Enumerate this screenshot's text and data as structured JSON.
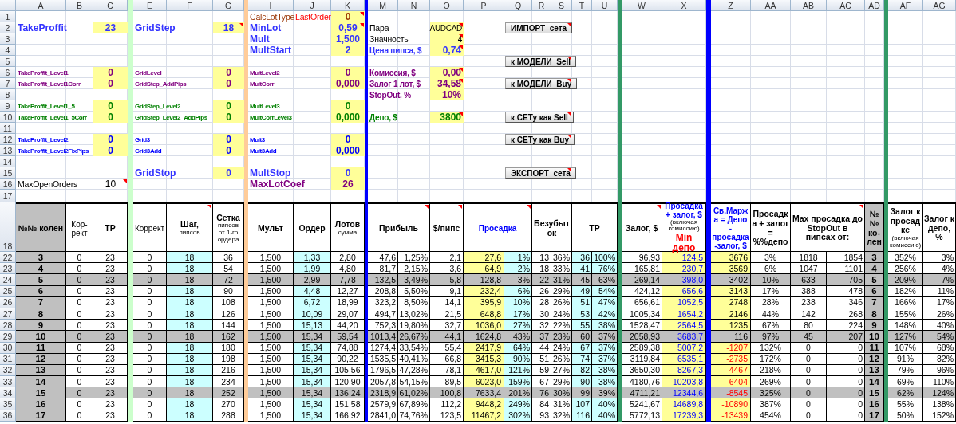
{
  "columns": [
    {
      "label": "A"
    },
    {
      "label": "B"
    },
    {
      "label": "C"
    },
    {
      "kind": "separator",
      "color": "#ccffcc"
    },
    {
      "label": "E"
    },
    {
      "label": "F"
    },
    {
      "label": "G"
    },
    {
      "kind": "separator",
      "color": "#ffcc99"
    },
    {
      "label": "I"
    },
    {
      "label": "J"
    },
    {
      "label": "K"
    },
    {
      "kind": "separator",
      "color": "#0000ff"
    },
    {
      "label": "M"
    },
    {
      "label": "N"
    },
    {
      "label": "O"
    },
    {
      "label": "P"
    },
    {
      "label": "Q"
    },
    {
      "label": "R"
    },
    {
      "label": "S"
    },
    {
      "label": "T"
    },
    {
      "label": "U"
    },
    {
      "kind": "separator",
      "color": "#339966"
    },
    {
      "label": "W"
    },
    {
      "label": "X"
    },
    {
      "kind": "separator",
      "color": "#0000ff"
    },
    {
      "label": "Z"
    },
    {
      "label": "AA"
    },
    {
      "label": "AB"
    },
    {
      "label": "AC"
    },
    {
      "label": "AD"
    },
    {
      "kind": "separator",
      "color": "#339966"
    },
    {
      "label": "AF"
    },
    {
      "label": "AG"
    }
  ],
  "parameter_rows": [
    {
      "number": "1",
      "I": {
        "kind": "calc_label",
        "text": "CalcLotType"
      },
      "J": {
        "kind": "warning_label",
        "text": "LastOrder"
      },
      "K": {
        "kind": "calc_value",
        "text": "0",
        "comment": true
      }
    },
    {
      "number": "2",
      "A": {
        "kind": "main_title",
        "text": "TakeProffit"
      },
      "C": {
        "kind": "main_value",
        "text": "23"
      },
      "E": {
        "kind": "main_title",
        "text": "GridStep"
      },
      "G": {
        "kind": "main_value",
        "text": "18",
        "comment": true
      },
      "I": {
        "kind": "main_title",
        "text": "MinLot"
      },
      "K": {
        "kind": "main_value",
        "text": "0,59",
        "comment": true
      },
      "M": {
        "kind": "plain_label",
        "text": "Пара"
      },
      "O": {
        "kind": "plain_entry",
        "text": "AUDCAD",
        "comment": true
      },
      "Q": {
        "kind": "button",
        "text": "ИМПОРТ  сета",
        "comment": true
      }
    },
    {
      "number": "3",
      "I": {
        "kind": "main_title",
        "text": "Mult"
      },
      "K": {
        "kind": "main_value",
        "text": "1,500"
      },
      "M": {
        "kind": "plain_label",
        "text": "Значность"
      },
      "O": {
        "kind": "plain_entry",
        "text": "4",
        "comment": true
      }
    },
    {
      "number": "4",
      "I": {
        "kind": "main_title",
        "text": "MultStart"
      },
      "K": {
        "kind": "main_value",
        "text": "2"
      },
      "M": {
        "kind": "main_heading",
        "text": "Цена пипса, $"
      },
      "O": {
        "kind": "main_amount",
        "text": "0,74",
        "comment": true
      }
    },
    {
      "number": "5",
      "Q": {
        "kind": "button",
        "text": "к МОДЕЛИ  Sell",
        "comment": true
      }
    },
    {
      "number": "6",
      "A": {
        "kind": "level1_small",
        "text": "TakeProffit_Level1"
      },
      "C": {
        "kind": "level1_value",
        "text": "0"
      },
      "E": {
        "kind": "level1_small",
        "text": "GridLevel"
      },
      "G": {
        "kind": "level1_value",
        "text": "0"
      },
      "I": {
        "kind": "level1_small",
        "text": "MultLevel2"
      },
      "K": {
        "kind": "level1_value",
        "text": "0"
      },
      "M": {
        "kind": "cost_heading",
        "text": "Комиссия, $"
      },
      "O": {
        "kind": "cost_amount",
        "text": "0,00",
        "comment": true
      }
    },
    {
      "number": "7",
      "A": {
        "kind": "level1_small",
        "text": "TakeProffit_Level1Corr"
      },
      "C": {
        "kind": "level1_value",
        "text": "0"
      },
      "E": {
        "kind": "level1_small",
        "text": "GridStep_AddPips"
      },
      "G": {
        "kind": "level1_value",
        "text": "0"
      },
      "I": {
        "kind": "level1_small",
        "text": "MultCorr"
      },
      "K": {
        "kind": "level1_value",
        "text": "0,000"
      },
      "M": {
        "kind": "cost_heading",
        "text": "Залог 1 лот, $"
      },
      "O": {
        "kind": "cost_amount",
        "text": "34,58",
        "comment": true
      },
      "Q": {
        "kind": "button",
        "text": "к МОДЕЛИ  Buy",
        "comment": true
      }
    },
    {
      "number": "8",
      "M": {
        "kind": "cost_heading",
        "text": "StopOut, %"
      },
      "O": {
        "kind": "cost_amount",
        "text": "10%"
      }
    },
    {
      "number": "9",
      "A": {
        "kind": "level15_small",
        "text": "TakeProffit_Level1_5"
      },
      "C": {
        "kind": "level15_value",
        "text": "0"
      },
      "E": {
        "kind": "level15_small",
        "text": "GridStep_Level2"
      },
      "G": {
        "kind": "level15_value",
        "text": "0"
      },
      "I": {
        "kind": "level15_small",
        "text": "MultLevel3"
      },
      "K": {
        "kind": "level15_value",
        "text": "0"
      }
    },
    {
      "number": "10",
      "A": {
        "kind": "level15_small",
        "text": "TakeProffit_Level1_5Corr"
      },
      "C": {
        "kind": "level15_value",
        "text": "0"
      },
      "E": {
        "kind": "level15_small",
        "text": "GridStep_Level2_AddPips"
      },
      "G": {
        "kind": "level15_value",
        "text": "0"
      },
      "I": {
        "kind": "level15_small",
        "text": "MultCorrLevel3"
      },
      "K": {
        "kind": "level15_value",
        "text": "0,000"
      },
      "M": {
        "kind": "deposit_heading",
        "text": "Депо, $"
      },
      "O": {
        "kind": "deposit_amount",
        "text": "3800",
        "comment": true
      },
      "Q": {
        "kind": "button",
        "text": "к СЕТу как Sell",
        "comment": true
      }
    },
    {
      "number": "11"
    },
    {
      "number": "12",
      "A": {
        "kind": "level2_small",
        "text": "TakeProffit_Level2"
      },
      "C": {
        "kind": "level2_value",
        "text": "0"
      },
      "E": {
        "kind": "level2_small",
        "text": "Grid3"
      },
      "G": {
        "kind": "level2_value",
        "text": "0"
      },
      "I": {
        "kind": "level2_small",
        "text": "Mult3"
      },
      "K": {
        "kind": "level2_value",
        "text": "0"
      },
      "Q": {
        "kind": "button",
        "text": "к СЕТу как Buy",
        "comment": true
      }
    },
    {
      "number": "13",
      "A": {
        "kind": "level2_small",
        "text": "TakeProffit_Level2FixPips"
      },
      "C": {
        "kind": "level2_value",
        "text": "0"
      },
      "E": {
        "kind": "level2_small",
        "text": "Grid3Add"
      },
      "G": {
        "kind": "level2_value",
        "text": "0"
      },
      "I": {
        "kind": "level2_small",
        "text": "Mult3Add"
      },
      "K": {
        "kind": "level2_value",
        "text": "0,000"
      }
    },
    {
      "number": "14"
    },
    {
      "number": "15",
      "E": {
        "kind": "main_title",
        "text": "GridStop"
      },
      "G": {
        "kind": "main_value",
        "text": "0"
      },
      "I": {
        "kind": "main_title",
        "text": "MultStop"
      },
      "K": {
        "kind": "main_value",
        "text": "0"
      },
      "Q": {
        "kind": "button",
        "text": "ЭКСПОРТ  сета",
        "comment": true
      }
    },
    {
      "number": "16",
      "A": {
        "kind": "plain_label",
        "text": "MaxOpenOrders"
      },
      "C": {
        "kind": "plain_number",
        "text": "10",
        "comment": true
      },
      "I": {
        "kind": "limit_title",
        "text": "MaxLotCoef"
      },
      "K": {
        "kind": "limit_value",
        "text": "26"
      }
    }
  ],
  "spacer_row": {
    "number": "17"
  },
  "table": {
    "header_row": "18",
    "headers": [
      {
        "kind": "index",
        "parts": [
          {
            "text": "№№ колен",
            "kind": "bold"
          }
        ]
      },
      {
        "kind": "normal",
        "parts": [
          {
            "text": "Кор-рект",
            "kind": "plain"
          }
        ]
      },
      {
        "kind": "normal",
        "parts": [
          {
            "text": "TP",
            "kind": "bold"
          }
        ]
      },
      {
        "kind": "normal",
        "parts": [
          {
            "text": "Коррект",
            "kind": "plain"
          }
        ]
      },
      {
        "kind": "normal",
        "parts": [
          {
            "text": "Шаг,",
            "kind": "bold"
          },
          {
            "text": "пипсов",
            "kind": "small"
          }
        ],
        "comment": true
      },
      {
        "kind": "normal",
        "parts": [
          {
            "text": "Сетка",
            "kind": "bold"
          },
          {
            "text": "пипсов от 1-го ордера",
            "kind": "small"
          }
        ]
      },
      {
        "kind": "normal",
        "parts": [
          {
            "text": "Мульт",
            "kind": "bold"
          }
        ]
      },
      {
        "kind": "normal",
        "parts": [
          {
            "text": "Ордер",
            "kind": "bold"
          }
        ]
      },
      {
        "kind": "normal",
        "parts": [
          {
            "text": "Лотов",
            "kind": "bold"
          },
          {
            "text": "сумма",
            "kind": "small"
          }
        ]
      },
      {
        "kind": "normal",
        "parts": [
          {
            "text": "Прибыль",
            "kind": "bold"
          }
        ],
        "wide": true,
        "comment": true
      },
      {
        "kind": "normal",
        "parts": [
          {
            "text": "$/пипс",
            "kind": "bold"
          }
        ],
        "comment": true
      },
      {
        "kind": "normal",
        "parts": [
          {
            "text": "Просадка",
            "kind": "blue"
          }
        ],
        "wide": true,
        "comment": true
      },
      {
        "kind": "normal",
        "parts": [
          {
            "text": "Безубыток",
            "kind": "bold"
          }
        ],
        "wide": true
      },
      {
        "kind": "normal",
        "parts": [
          {
            "text": "TP",
            "kind": "bold"
          }
        ],
        "wide": true
      },
      {
        "kind": "normal",
        "parts": [
          {
            "text": "Залог, $",
            "kind": "bold"
          }
        ],
        "comment": true
      },
      {
        "kind": "normal",
        "parts": [
          {
            "text": "Просадка + залог, $",
            "kind": "blue"
          },
          {
            "text": "(включая комиссию)",
            "kind": "small"
          },
          {
            "text": "Min депо",
            "kind": "red"
          }
        ]
      },
      {
        "kind": "normal",
        "parts": [
          {
            "text": "Св.Маржа = Депо - просадка-залог, $",
            "kind": "blue"
          }
        ]
      },
      {
        "kind": "normal",
        "parts": [
          {
            "text": "Просадка + залог = %%депо",
            "kind": "bold"
          }
        ]
      },
      {
        "kind": "normal",
        "parts": [
          {
            "text": "Max просадка до StopOut в пипсах от:",
            "kind": "bold"
          }
        ],
        "wide": true,
        "comment": true
      },
      {
        "kind": "index",
        "parts": [
          {
            "text": "№№ ко-лен",
            "kind": "bold"
          }
        ]
      },
      {
        "kind": "normal",
        "parts": [
          {
            "text": "Залог к просадке",
            "kind": "bold"
          },
          {
            "text": "(включая комиссию)",
            "kind": "small"
          }
        ]
      },
      {
        "kind": "normal",
        "parts": [
          {
            "text": "Залог к депо, %",
            "kind": "bold"
          }
        ]
      }
    ],
    "columns": [
      {
        "kind": "index"
      },
      {
        "kind": "centered"
      },
      {
        "kind": "centered"
      },
      {
        "kind": "centered"
      },
      {
        "kind": "input"
      },
      {
        "kind": "centered"
      },
      {
        "kind": "centered"
      },
      {
        "kind": "input"
      },
      {
        "kind": "centered"
      },
      {
        "kind": "number"
      },
      {
        "kind": "number"
      },
      {
        "kind": "number"
      },
      {
        "kind": "drawdown"
      },
      {
        "kind": "input_number"
      },
      {
        "kind": "number"
      },
      {
        "kind": "number"
      },
      {
        "kind": "input_number"
      },
      {
        "kind": "input_number"
      },
      {
        "kind": "number"
      },
      {
        "kind": "total"
      },
      {
        "kind": "margin"
      },
      {
        "kind": "centered"
      },
      {
        "kind": "centered"
      },
      {
        "kind": "number"
      },
      {
        "kind": "index"
      },
      {
        "kind": "centered"
      },
      {
        "kind": "number"
      }
    ],
    "rows": [
      {
        "number": "22",
        "highlighted": false,
        "negative_margin": false,
        "cells": [
          "3",
          "0",
          "23",
          "0",
          "18",
          "36",
          "1,500",
          "1,33",
          "2,80",
          "47,6",
          "1,25%",
          "2,1",
          "27,6",
          "1%",
          "13",
          "36%",
          "36",
          "100%",
          "96,93",
          "124,5",
          "3676",
          "3%",
          "1818",
          "1854",
          "3",
          "352%",
          "3%"
        ]
      },
      {
        "number": "23",
        "highlighted": false,
        "negative_margin": false,
        "cells": [
          "4",
          "0",
          "23",
          "0",
          "18",
          "54",
          "1,500",
          "1,99",
          "4,80",
          "81,7",
          "2,15%",
          "3,6",
          "64,9",
          "2%",
          "18",
          "33%",
          "41",
          "76%",
          "165,81",
          "230,7",
          "3569",
          "6%",
          "1047",
          "1101",
          "4",
          "256%",
          "4%"
        ]
      },
      {
        "number": "24",
        "highlighted": true,
        "negative_margin": false,
        "cells": [
          "5",
          "0",
          "23",
          "0",
          "18",
          "72",
          "1,500",
          "2,99",
          "7,78",
          "132,5",
          "3,49%",
          "5,8",
          "128,8",
          "3%",
          "22",
          "31%",
          "45",
          "63%",
          "269,14",
          "398,0",
          "3402",
          "10%",
          "633",
          "705",
          "5",
          "209%",
          "7%"
        ]
      },
      {
        "number": "25",
        "highlighted": false,
        "negative_margin": false,
        "cells": [
          "6",
          "0",
          "23",
          "0",
          "18",
          "90",
          "1,500",
          "4,48",
          "12,27",
          "208,8",
          "5,50%",
          "9,1",
          "232,4",
          "6%",
          "26",
          "29%",
          "49",
          "54%",
          "424,12",
          "656,6",
          "3143",
          "17%",
          "388",
          "478",
          "6",
          "182%",
          "11%"
        ]
      },
      {
        "number": "26",
        "highlighted": false,
        "negative_margin": false,
        "cells": [
          "7",
          "0",
          "23",
          "0",
          "18",
          "108",
          "1,500",
          "6,72",
          "18,99",
          "323,2",
          "8,50%",
          "14,1",
          "395,9",
          "10%",
          "28",
          "26%",
          "51",
          "47%",
          "656,61",
          "1052,5",
          "2748",
          "28%",
          "238",
          "346",
          "7",
          "166%",
          "17%"
        ]
      },
      {
        "number": "27",
        "highlighted": false,
        "negative_margin": false,
        "cells": [
          "8",
          "0",
          "23",
          "0",
          "18",
          "126",
          "1,500",
          "10,09",
          "29,07",
          "494,7",
          "13,02%",
          "21,5",
          "648,8",
          "17%",
          "30",
          "24%",
          "53",
          "42%",
          "1005,34",
          "1654,2",
          "2146",
          "44%",
          "142",
          "268",
          "8",
          "155%",
          "26%"
        ]
      },
      {
        "number": "28",
        "highlighted": false,
        "negative_margin": false,
        "cells": [
          "9",
          "0",
          "23",
          "0",
          "18",
          "144",
          "1,500",
          "15,13",
          "44,20",
          "752,3",
          "19,80%",
          "32,7",
          "1036,0",
          "27%",
          "32",
          "22%",
          "55",
          "38%",
          "1528,47",
          "2564,5",
          "1235",
          "67%",
          "80",
          "224",
          "9",
          "148%",
          "40%"
        ]
      },
      {
        "number": "29",
        "highlighted": true,
        "negative_margin": false,
        "cells": [
          "10",
          "0",
          "23",
          "0",
          "18",
          "162",
          "1,500",
          "15,34",
          "59,54",
          "1013,4",
          "26,67%",
          "44,1",
          "1624,8",
          "43%",
          "37",
          "23%",
          "60",
          "37%",
          "2058,93",
          "3683,7",
          "116",
          "97%",
          "45",
          "207",
          "10",
          "127%",
          "54%"
        ]
      },
      {
        "number": "30",
        "highlighted": false,
        "negative_margin": true,
        "cells": [
          "11",
          "0",
          "23",
          "0",
          "18",
          "180",
          "1,500",
          "15,34",
          "74,88",
          "1274,4",
          "33,54%",
          "55,4",
          "2417,9",
          "64%",
          "44",
          "24%",
          "67",
          "37%",
          "2589,38",
          "5007,2",
          "-1207",
          "132%",
          "0",
          "0",
          "11",
          "107%",
          "68%"
        ]
      },
      {
        "number": "31",
        "highlighted": false,
        "negative_margin": true,
        "cells": [
          "12",
          "0",
          "23",
          "0",
          "18",
          "198",
          "1,500",
          "15,34",
          "90,22",
          "1535,5",
          "40,41%",
          "66,8",
          "3415,3",
          "90%",
          "51",
          "26%",
          "74",
          "37%",
          "3119,84",
          "6535,1",
          "-2735",
          "172%",
          "0",
          "0",
          "12",
          "91%",
          "82%"
        ]
      },
      {
        "number": "32",
        "highlighted": false,
        "negative_margin": true,
        "cells": [
          "13",
          "0",
          "23",
          "0",
          "18",
          "216",
          "1,500",
          "15,34",
          "105,56",
          "1796,5",
          "47,28%",
          "78,1",
          "4617,0",
          "121%",
          "59",
          "27%",
          "82",
          "38%",
          "3650,30",
          "8267,3",
          "-4467",
          "218%",
          "0",
          "0",
          "13",
          "79%",
          "96%"
        ]
      },
      {
        "number": "33",
        "highlighted": false,
        "negative_margin": true,
        "cells": [
          "14",
          "0",
          "23",
          "0",
          "18",
          "234",
          "1,500",
          "15,34",
          "120,90",
          "2057,8",
          "54,15%",
          "89,5",
          "6023,0",
          "159%",
          "67",
          "29%",
          "90",
          "38%",
          "4180,76",
          "10203,8",
          "-6404",
          "269%",
          "0",
          "0",
          "14",
          "69%",
          "110%"
        ]
      },
      {
        "number": "34",
        "highlighted": true,
        "negative_margin": true,
        "cells": [
          "15",
          "0",
          "23",
          "0",
          "18",
          "252",
          "1,500",
          "15,34",
          "136,24",
          "2318,9",
          "61,02%",
          "100,8",
          "7633,4",
          "201%",
          "76",
          "30%",
          "99",
          "39%",
          "4711,21",
          "12344,6",
          "-8545",
          "325%",
          "0",
          "0",
          "15",
          "62%",
          "124%"
        ]
      },
      {
        "number": "35",
        "highlighted": false,
        "negative_margin": true,
        "cells": [
          "16",
          "0",
          "23",
          "0",
          "18",
          "270",
          "1,500",
          "15,34",
          "151,58",
          "2579,9",
          "67,89%",
          "112,2",
          "9448,2",
          "249%",
          "84",
          "31%",
          "107",
          "40%",
          "5241,67",
          "14689,8",
          "-10890",
          "387%",
          "0",
          "0",
          "16",
          "55%",
          "138%"
        ]
      },
      {
        "number": "36",
        "highlighted": false,
        "negative_margin": true,
        "cells": [
          "17",
          "0",
          "23",
          "0",
          "18",
          "288",
          "1,500",
          "15,34",
          "166,92",
          "2841,0",
          "74,76%",
          "123,5",
          "11467,2",
          "302%",
          "93",
          "32%",
          "116",
          "40%",
          "5772,13",
          "17239,3",
          "-13439",
          "454%",
          "0",
          "0",
          "17",
          "50%",
          "152%"
        ]
      }
    ]
  }
}
